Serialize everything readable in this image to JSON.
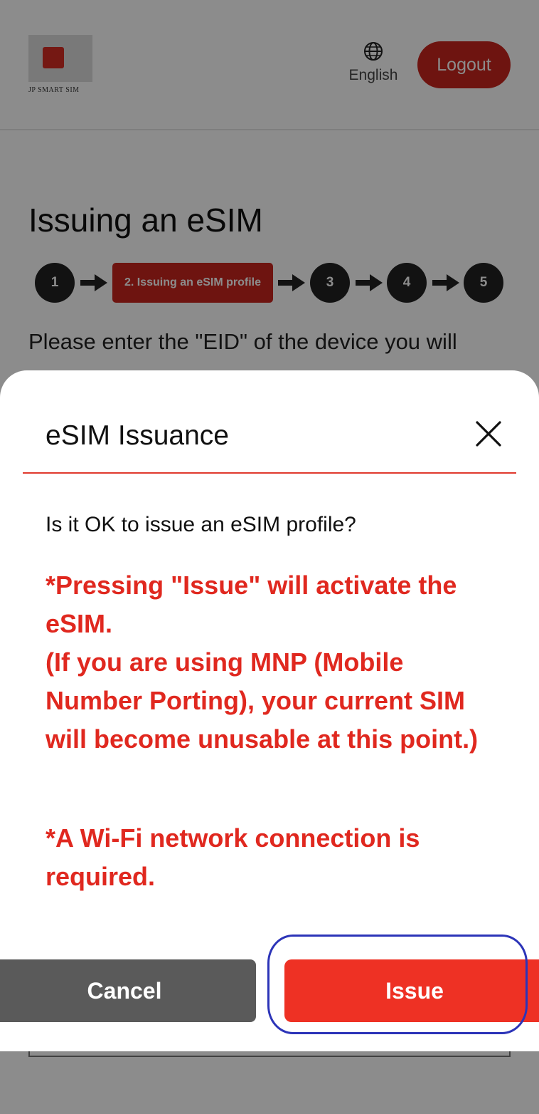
{
  "header": {
    "logo_text": "JP SMART SIM",
    "language_label": "English",
    "logout_label": "Logout"
  },
  "main": {
    "title": "Issuing an eSIM",
    "steps": [
      "1",
      "2. Issuing an eSIM profile",
      "3",
      "4",
      "5"
    ],
    "instructions": "Please enter the \"EID\" of the device you will"
  },
  "modal": {
    "title": "eSIM Issuance",
    "question": "Is it OK to issue an eSIM profile?",
    "warning_activate": "*Pressing \"Issue\" will activate the eSIM.",
    "warning_mnp": "(If you are using MNP (Mobile Number Porting), your current SIM will become unusable at this point.)",
    "warning_wifi": "*A Wi-Fi network connection is required.",
    "cancel_label": "Cancel",
    "issue_label": "Issue"
  },
  "colors": {
    "brand_red": "#c9261e",
    "issue_red": "#ee3124",
    "warning_red": "#e0281f",
    "cancel_gray": "#5a5a5a",
    "highlight_blue": "#2c34b8"
  }
}
